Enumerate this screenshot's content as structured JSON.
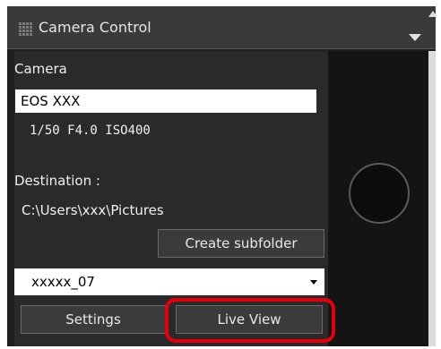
{
  "window": {
    "title": "Camera Control"
  },
  "camera": {
    "section_label": "Camera",
    "model": "EOS XXX",
    "status": "1/50  F4.0  ISO400"
  },
  "destination": {
    "label": "Destination :",
    "path": "C:\\Users\\xxx\\Pictures",
    "create_subfolder_label": "Create subfolder",
    "subfolder_value": "xxxxx_07"
  },
  "buttons": {
    "settings": "Settings",
    "live_view": "Live View"
  },
  "colors": {
    "highlight": "#e3000b",
    "panel_bg": "#2a2a2a",
    "titlebar_bg": "#3a3a3a"
  },
  "icons": [
    "grip-icon",
    "dropdown-triangle-icon",
    "scroll-up-icon",
    "chevron-down-icon",
    "shutter-knob-icon"
  ]
}
